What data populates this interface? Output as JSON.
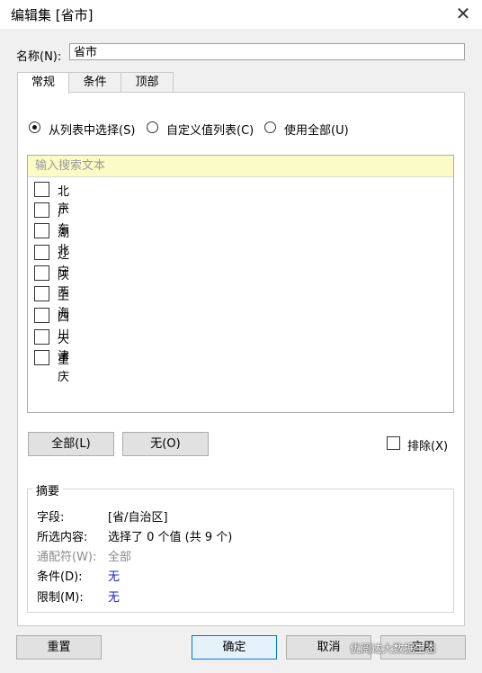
{
  "window": {
    "title": "编辑集 [省市]",
    "close_glyph": "✕"
  },
  "name": {
    "label": "名称(N):",
    "value": "省市"
  },
  "tabs": [
    {
      "label": "常规",
      "active": true
    },
    {
      "label": "条件",
      "active": false
    },
    {
      "label": "顶部",
      "active": false
    }
  ],
  "selection_mode": {
    "options": [
      {
        "label": "从列表中选择(S)",
        "selected": true
      },
      {
        "label": "自定义值列表(C)",
        "selected": false
      },
      {
        "label": "使用全部(U)",
        "selected": false
      }
    ]
  },
  "list": {
    "search_placeholder": "输入搜索文本",
    "items": [
      {
        "label": "北京",
        "checked": false
      },
      {
        "label": "广东",
        "checked": false
      },
      {
        "label": "湖北",
        "checked": false
      },
      {
        "label": "辽宁",
        "checked": false
      },
      {
        "label": "陕西",
        "checked": false
      },
      {
        "label": "上海",
        "checked": false
      },
      {
        "label": "四川",
        "checked": false
      },
      {
        "label": "天津",
        "checked": false
      },
      {
        "label": "重庆",
        "checked": false
      }
    ]
  },
  "list_buttons": {
    "all": "全部(L)",
    "none": "无(O)",
    "exclude": "排除(X)"
  },
  "summary": {
    "title": "摘要",
    "rows": [
      {
        "key": "字段:",
        "value": "[省/自治区]"
      },
      {
        "key": "所选内容:",
        "value": "选择了 0 个值 (共 9 个)"
      },
      {
        "key": "通配符(W):",
        "value": "全部"
      },
      {
        "key": "条件(D):",
        "value": "无"
      },
      {
        "key": "限制(M):",
        "value": "无"
      }
    ]
  },
  "footer": {
    "reset": "重置",
    "ok": "确定",
    "cancel": "取消",
    "apply": "应用"
  },
  "watermark": "优阅达大数据生态",
  "colors": {
    "accent_blue": "#0078d7",
    "search_bg": "#fbfbc5",
    "value_blue": "#2020d0"
  }
}
